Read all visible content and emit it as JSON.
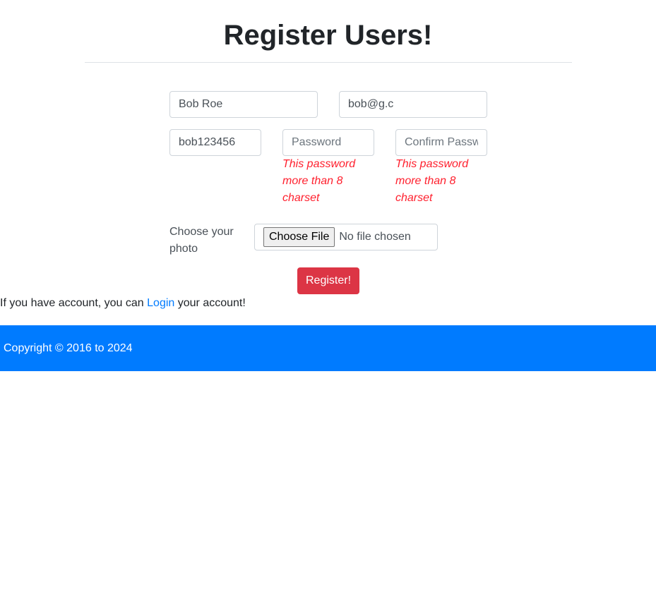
{
  "header": {
    "title": "Register Users!"
  },
  "form": {
    "name_value": "Bob Roe",
    "email_value": "bob@g.c",
    "username_value": "bob123456",
    "password_placeholder": "Password",
    "confirm_placeholder": "Confirm Password",
    "password_error": "This password more than 8 charset",
    "confirm_error": "This password more than 8 charset",
    "photo_label": "Choose your photo",
    "file_button_label": "Choose File",
    "file_status": "No file chosen",
    "submit_label": "Register!"
  },
  "login_prompt": {
    "prefix": "If you have account, you can ",
    "link_label": "Login",
    "suffix": " your account!"
  },
  "footer": {
    "copyright": "Copyright © 2016 to 2024"
  },
  "colors": {
    "accent": "#007bff",
    "danger": "#dc3545",
    "error_text": "#ff1f2d"
  }
}
